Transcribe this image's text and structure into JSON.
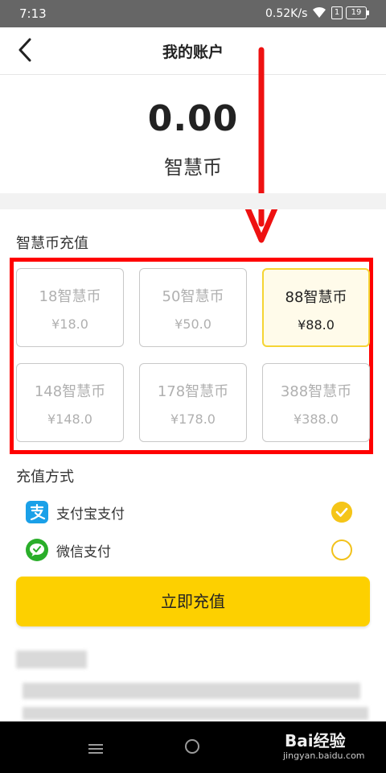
{
  "status_bar": {
    "time": "7:13",
    "speed": "0.52K/s",
    "sim_badge": "1",
    "battery": "19"
  },
  "header": {
    "title": "我的账户",
    "back_icon": "chevron-left-icon"
  },
  "balance": {
    "value": "0.00",
    "unit": "智慧币"
  },
  "recharge": {
    "title": "智慧币充值",
    "selected_index": 2,
    "options": [
      {
        "name": "18智慧币",
        "price": "¥18.0"
      },
      {
        "name": "50智慧币",
        "price": "¥50.0"
      },
      {
        "name": "88智慧币",
        "price": "¥88.0"
      },
      {
        "name": "148智慧币",
        "price": "¥148.0"
      },
      {
        "name": "178智慧币",
        "price": "¥178.0"
      },
      {
        "name": "388智慧币",
        "price": "¥388.0"
      }
    ]
  },
  "payment": {
    "title": "充值方式",
    "methods": [
      {
        "label": "支付宝支付",
        "icon": "alipay-icon",
        "selected": true
      },
      {
        "label": "微信支付",
        "icon": "wechat-icon",
        "selected": false
      }
    ]
  },
  "submit_label": "立即充值",
  "watermark": {
    "brand": "Bai经验",
    "url": "jingyan.baidu.com"
  },
  "colors": {
    "accent": "#fdd000",
    "annotation": "#ff0000",
    "alipay": "#1aa0e8",
    "wechat": "#2aae2a"
  }
}
